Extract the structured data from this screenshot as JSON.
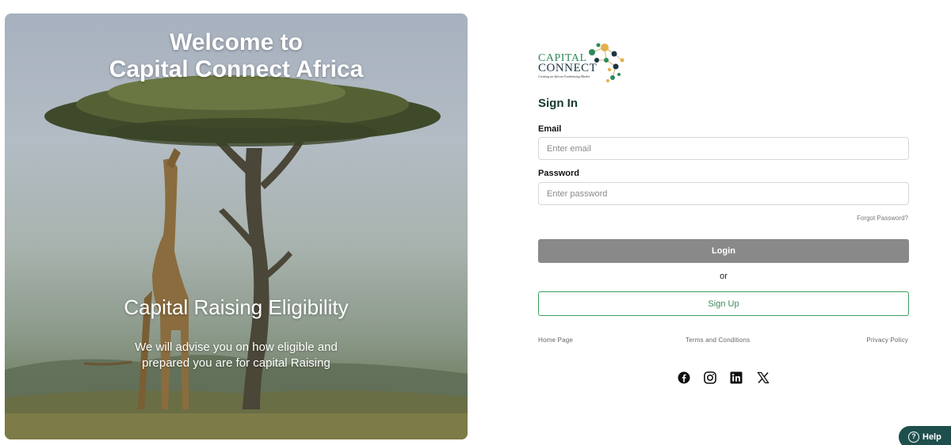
{
  "hero": {
    "title_line1": "Welcome to",
    "title_line2": "Capital Connect Africa",
    "subtitle": "Capital Raising Eligibility",
    "description": "We will advise you on how eligible and prepared you are for capital Raising"
  },
  "logo": {
    "line1": "CAPITAL",
    "line2": "CONNECT",
    "tagline": "Creating an African Fundraising Market",
    "colors": {
      "green": "#2f8a5a",
      "navy": "#1d3540",
      "gold": "#e3b04b"
    }
  },
  "signin": {
    "title": "Sign In",
    "email_label": "Email",
    "email_placeholder": "Enter email",
    "email_value": "",
    "password_label": "Password",
    "password_placeholder": "Enter password",
    "password_value": "",
    "forgot_label": "Forgot Password?",
    "login_label": "Login",
    "or_label": "or",
    "signup_label": "Sign Up"
  },
  "footer": {
    "home_label": "Home Page",
    "terms_label": "Terms and Conditions",
    "privacy_label": "Privacy Policy"
  },
  "social": [
    "facebook-icon",
    "instagram-icon",
    "linkedin-icon",
    "x-icon"
  ],
  "help": {
    "label": "Help"
  },
  "colors": {
    "accent_green": "#3aa05e",
    "login_button": "#898989",
    "help_button": "#1e4f4d",
    "title_text": "#173a2f"
  }
}
